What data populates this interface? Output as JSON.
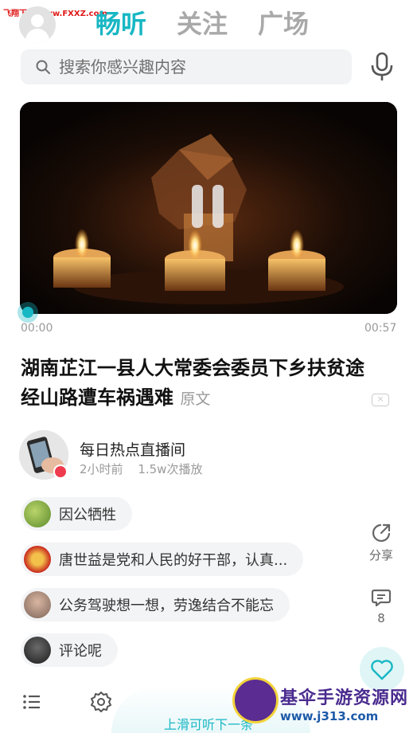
{
  "watermark": {
    "text": "飞翔下载 www.FXXZ.com"
  },
  "header": {
    "tabs": [
      {
        "label": "畅听",
        "active": true
      },
      {
        "label": "关注",
        "active": false
      },
      {
        "label": "广场",
        "active": false
      }
    ],
    "accent_color": "#18b7c4"
  },
  "search": {
    "placeholder": "搜索你感兴趣内容",
    "icon": "search-icon",
    "voice_icon": "microphone-icon"
  },
  "player": {
    "state": "playing",
    "control_icon": "pause-icon",
    "current_time": "00:00",
    "duration": "00:57",
    "progress": 0
  },
  "article": {
    "title": "湖南芷江一县人大常委会委员下乡扶贫途经山路遭车祸遇难",
    "original_link": "原文",
    "close_icon": "close-icon"
  },
  "channel": {
    "name": "每日热点直播间",
    "time_ago": "2小时前",
    "plays": "1.5w次播放",
    "badge_icon": "heart-icon"
  },
  "comments": [
    {
      "text": "因公牺牲"
    },
    {
      "text": "唐世益是党和人民的好干部，认真..."
    },
    {
      "text": "公务驾驶想一想，劳逸结合不能忘"
    },
    {
      "text": "评论呢"
    }
  ],
  "side_actions": {
    "share_label": "分享",
    "comment_count": "8"
  },
  "bottom": {
    "swipe_hint": "上滑可听下一条",
    "list_icon": "list-icon",
    "settings_icon": "gear-icon",
    "like_icon": "heart-icon"
  },
  "logo": {
    "brand": "基伞手游资源网",
    "url": "www.j313.com"
  }
}
